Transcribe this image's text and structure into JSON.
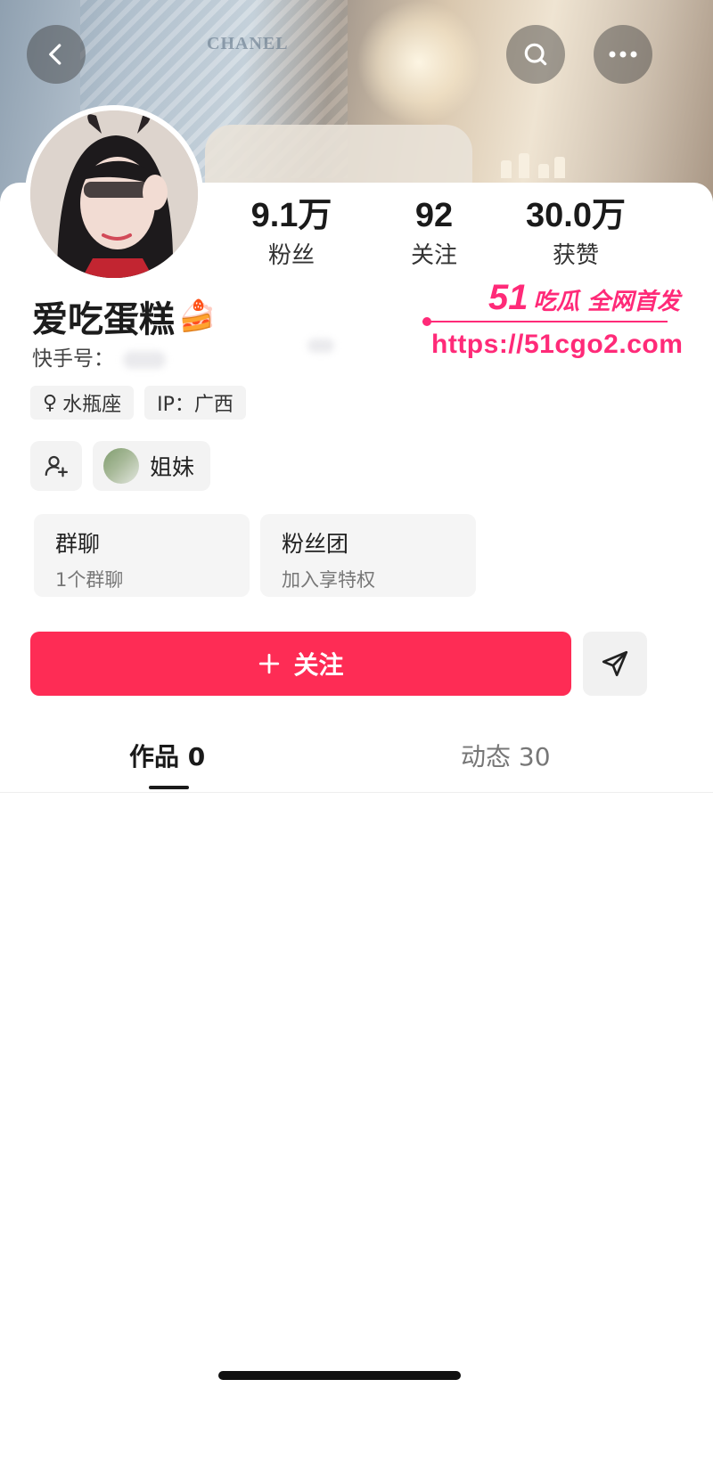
{
  "cover": {
    "brand_text": "CHANEL"
  },
  "header": {
    "back_icon": "chevron-left-icon",
    "search_icon": "search-icon",
    "more_icon": "more-horizontal-icon"
  },
  "stats": [
    {
      "num": "9.1万",
      "label": "粉丝"
    },
    {
      "num": "92",
      "label": "关注"
    },
    {
      "num": "30.0万",
      "label": "获赞"
    }
  ],
  "profile": {
    "name": "爱吃蛋糕",
    "name_emoji": "🍰",
    "handle_label": "快手号："
  },
  "watermark": {
    "brand_big": "51",
    "brand_small": "吃瓜 全网首发",
    "url": "https://51cgo2.com"
  },
  "tags": {
    "zodiac_symbol": "♀",
    "zodiac": "水瓶座",
    "ip": "IP：广西"
  },
  "relation": {
    "label": "姐妹"
  },
  "boxes": {
    "group": {
      "title": "群聊",
      "subtitle": "1个群聊"
    },
    "fanclub": {
      "title": "粉丝团",
      "subtitle": "加入享特权"
    }
  },
  "actions": {
    "follow_label": "关注",
    "follow_color": "#fe2c55"
  },
  "tabs": [
    {
      "label": "作品 0",
      "active": true
    },
    {
      "label": "动态 30",
      "active": false
    }
  ]
}
